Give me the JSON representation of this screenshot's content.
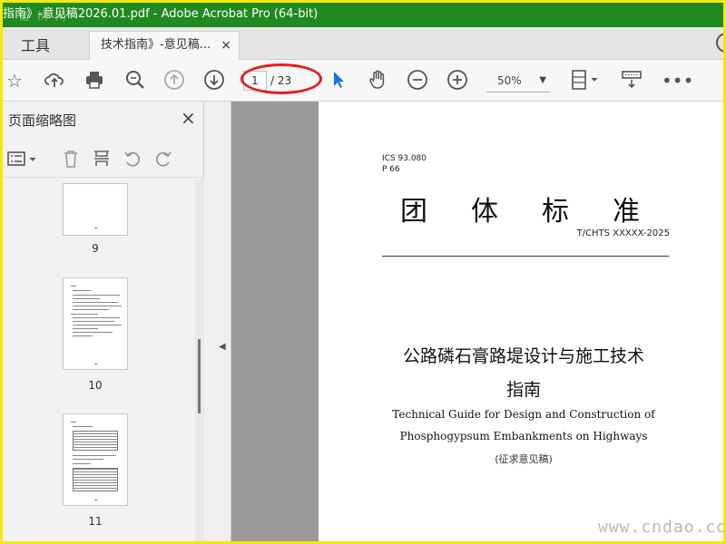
{
  "window": {
    "title": "指南》-意见稿2026.01.pdf - Adobe Acrobat Pro (64-bit)",
    "watermark_top": "道 树 网"
  },
  "tabs": {
    "tools_label": "工具",
    "document_tab_label": "技术指南》-意见稿...",
    "close_glyph": "×"
  },
  "toolbar": {
    "current_page": "1",
    "total_pages": "/ 23",
    "zoom": "50%"
  },
  "left_panel": {
    "title": "页面缩略图",
    "close_glyph": "×",
    "thumbnails": [
      {
        "label": "9"
      },
      {
        "label": "10"
      },
      {
        "label": "11"
      }
    ]
  },
  "document": {
    "ics": "ICS 93.080",
    "p_code": "P 66",
    "standard_type": "团体标准",
    "standard_code": "T/CHTS  XXXXX-2025",
    "title_zh_line1": "公路磷石膏路堤设计与施工技术",
    "title_zh_line2": "指南",
    "title_en_line1": "Technical Guide for Design and Construction of",
    "title_en_line2": "Phosphogypsum Embankments on Highways",
    "draft_label": "(征求意见稿)"
  },
  "watermark_bottom": "www.cndao.com",
  "colors": {
    "titlebar": "#1f8a1f",
    "highlight_ellipse": "#e02020",
    "frame": "#f5e90a",
    "select_arrow": "#1473e6"
  }
}
